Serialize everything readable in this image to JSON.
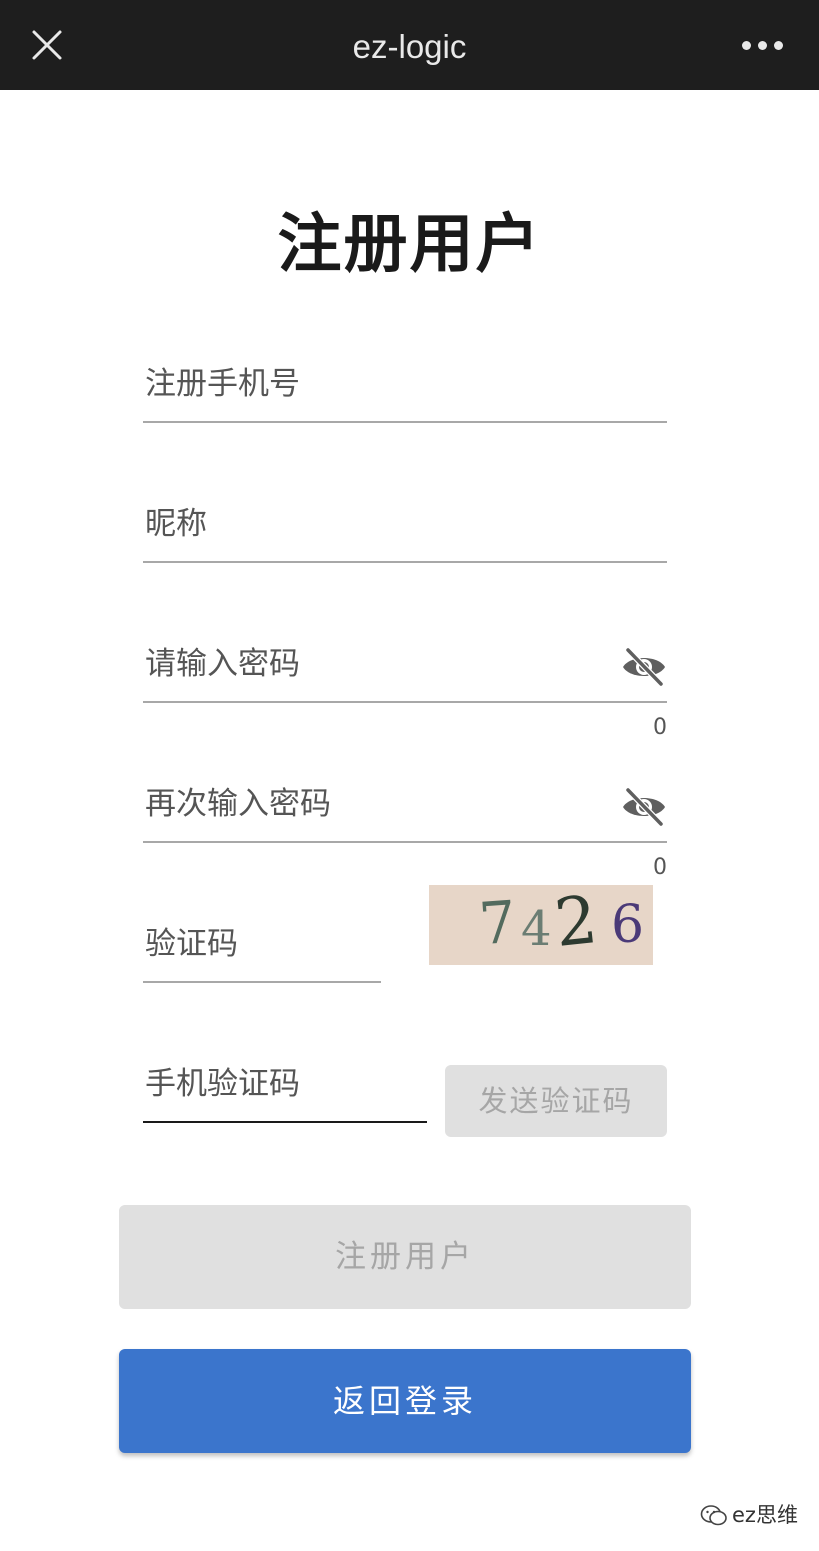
{
  "app_bar": {
    "title": "ez-logic",
    "close_icon": "close-icon",
    "more_icon": "more-dots-icon"
  },
  "page": {
    "title": "注册用户"
  },
  "form": {
    "phone": {
      "placeholder": "注册手机号",
      "value": ""
    },
    "nickname": {
      "placeholder": "昵称",
      "value": ""
    },
    "password": {
      "placeholder": "请输入密码",
      "value": "",
      "counter": "0",
      "toggle_icon": "eye-off-icon"
    },
    "password_confirm": {
      "placeholder": "再次输入密码",
      "value": "",
      "counter": "0",
      "toggle_icon": "eye-off-icon"
    },
    "captcha": {
      "placeholder": "验证码",
      "value": "",
      "image_text": [
        "7",
        "4",
        "2",
        "6"
      ]
    },
    "sms_code": {
      "placeholder": "手机验证码",
      "value": ""
    },
    "send_code_label": "发送验证码"
  },
  "actions": {
    "register_label": "注册用户",
    "back_label": "返回登录"
  },
  "colors": {
    "app_bar": "#1e1e1e",
    "primary": "#3b75cc",
    "disabled_bg": "#e0e0e0",
    "disabled_text": "#a6a6a6",
    "captcha_bg": "#e7d6c8"
  },
  "watermark": {
    "text": "ez思维"
  }
}
